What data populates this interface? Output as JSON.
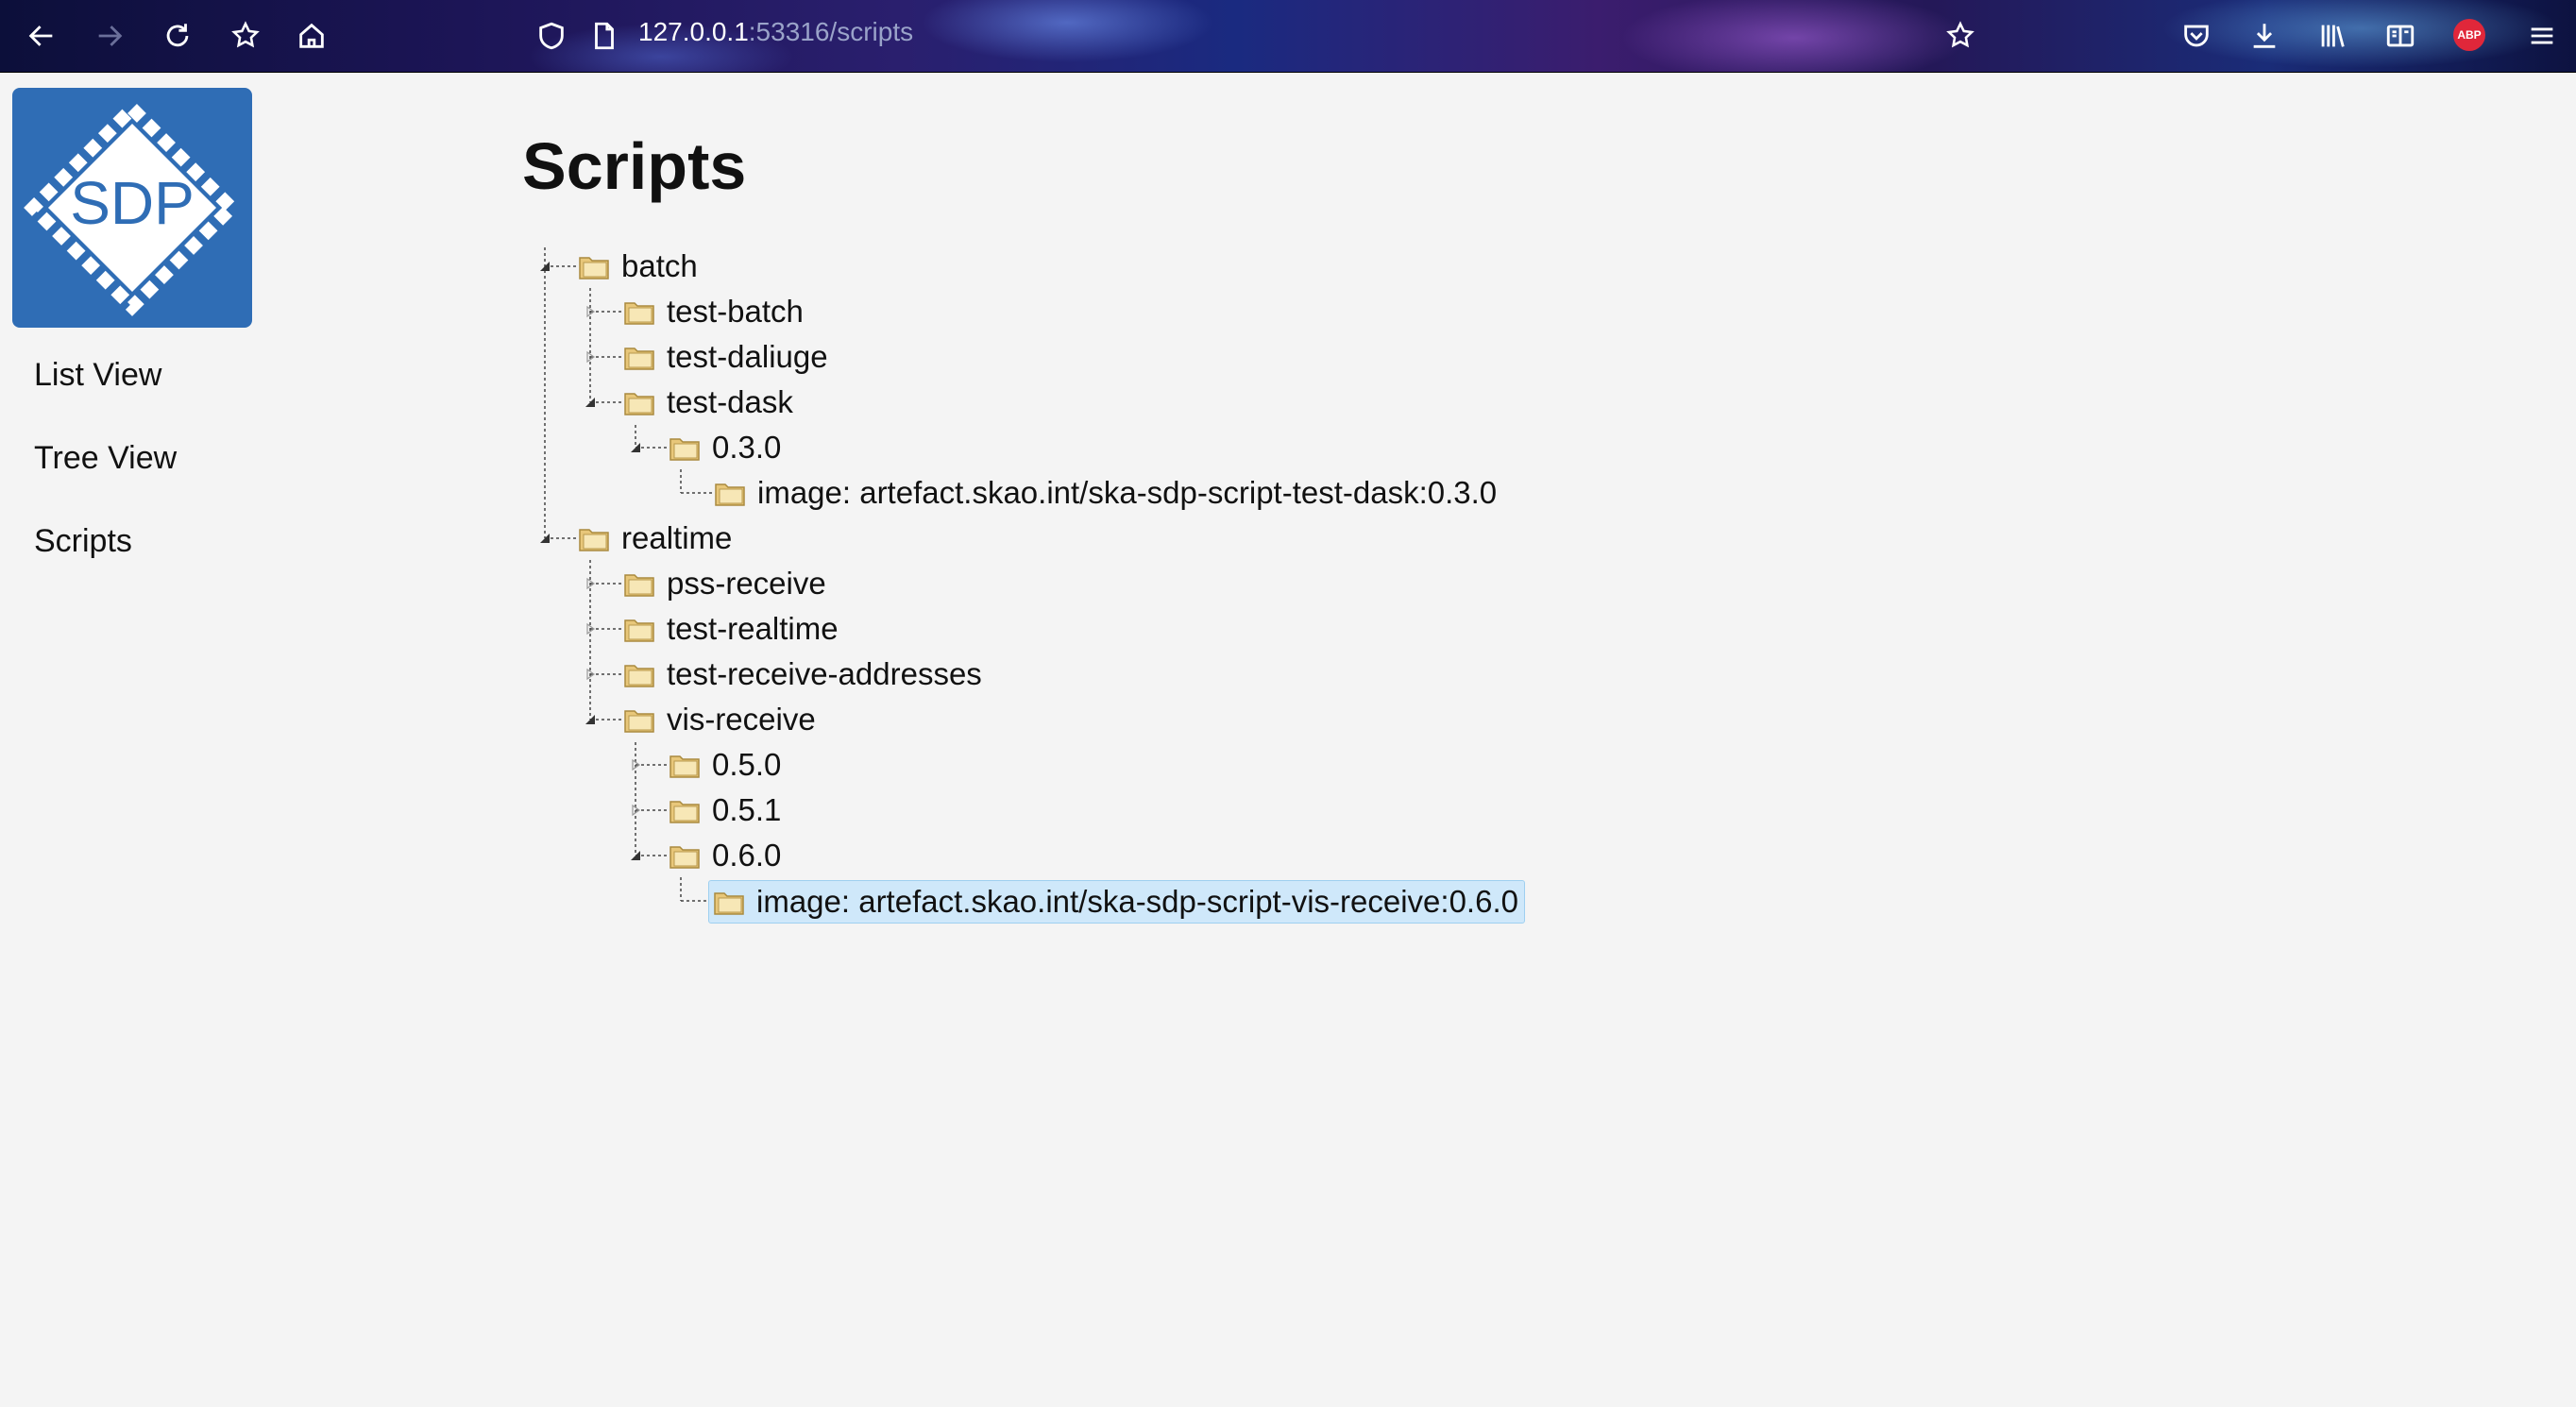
{
  "browser": {
    "url_host": "127.0.0.1",
    "url_rest": ":53316/scripts",
    "adblock_label": "ABP"
  },
  "sidebar": {
    "logo_text": "SDP",
    "items": [
      {
        "label": "List View"
      },
      {
        "label": "Tree View"
      },
      {
        "label": "Scripts"
      }
    ]
  },
  "main": {
    "title": "Scripts",
    "tree": [
      {
        "label": "batch",
        "level": 0,
        "expanded": true
      },
      {
        "label": "test-batch",
        "level": 1,
        "expanded": false
      },
      {
        "label": "test-daliuge",
        "level": 1,
        "expanded": false
      },
      {
        "label": "test-dask",
        "level": 1,
        "expanded": true
      },
      {
        "label": "0.3.0",
        "level": 2,
        "expanded": true
      },
      {
        "label": "image: artefact.skao.int/ska-sdp-script-test-dask:0.3.0",
        "level": 3,
        "leaf": true
      },
      {
        "label": "realtime",
        "level": 0,
        "expanded": true
      },
      {
        "label": "pss-receive",
        "level": 1,
        "expanded": false
      },
      {
        "label": "test-realtime",
        "level": 1,
        "expanded": false
      },
      {
        "label": "test-receive-addresses",
        "level": 1,
        "expanded": false
      },
      {
        "label": "vis-receive",
        "level": 1,
        "expanded": true
      },
      {
        "label": "0.5.0",
        "level": 2,
        "expanded": false
      },
      {
        "label": "0.5.1",
        "level": 2,
        "expanded": false
      },
      {
        "label": "0.6.0",
        "level": 2,
        "expanded": true
      },
      {
        "label": "image: artefact.skao.int/ska-sdp-script-vis-receive:0.6.0",
        "level": 3,
        "leaf": true,
        "selected": true
      }
    ]
  },
  "colors": {
    "logo_bg": "#2f6db5",
    "selection_bg": "#cfe8fa",
    "page_bg": "#f4f4f4"
  }
}
